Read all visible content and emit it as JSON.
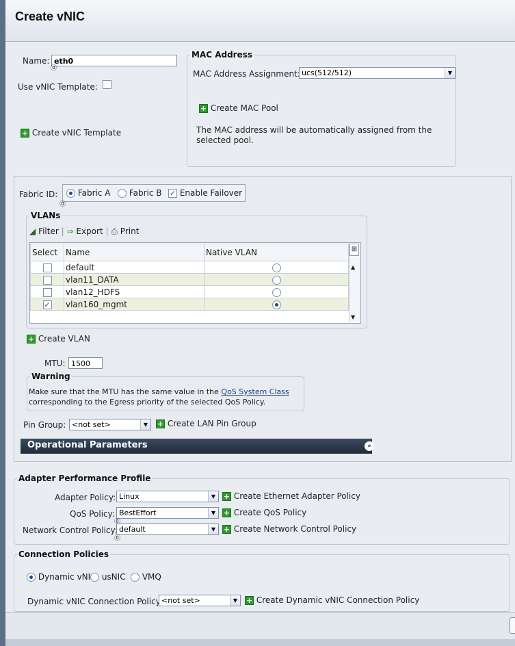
{
  "dialog": {
    "title": "Create vNIC"
  },
  "identity": {
    "name_label": "Name:",
    "name_value": "eth0",
    "use_template_label": "Use vNIC Template:",
    "create_template": "Create vNIC Template"
  },
  "mac": {
    "legend": "MAC Address",
    "assignment_label": "MAC Address Assignment:",
    "assignment_value": "ucs(512/512)",
    "create_pool": "Create MAC Pool",
    "info": "The MAC address will be automatically assigned from the selected pool."
  },
  "fabric": {
    "label": "Fabric ID:",
    "fabric_a": "Fabric A",
    "fabric_b": "Fabric B",
    "failover": "Enable Failover"
  },
  "vlans": {
    "legend": "VLANs",
    "toolbar": {
      "filter": "Filter",
      "export": "Export",
      "print": "Print"
    },
    "columns": [
      "Select",
      "Name",
      "Native VLAN"
    ],
    "rows": [
      {
        "name": "default",
        "selected": false,
        "native": false
      },
      {
        "name": "vlan11_DATA",
        "selected": false,
        "native": false
      },
      {
        "name": "vlan12_HDFS",
        "selected": false,
        "native": false
      },
      {
        "name": "vlan160_mgmt",
        "selected": true,
        "native": true
      }
    ],
    "create_vlan": "Create VLAN"
  },
  "mtu": {
    "label": "MTU:",
    "value": "1500"
  },
  "warning": {
    "legend": "Warning",
    "text_1": "Make sure that the MTU has the same value in the",
    "link": "QoS System Class",
    "text_2": "corresponding to the Egress priority of the selected QoS Policy."
  },
  "pin_group": {
    "label": "Pin Group:",
    "value": "<not set>",
    "create": "Create LAN Pin Group"
  },
  "operational": {
    "label": "Operational Parameters"
  },
  "adapter": {
    "legend": "Adapter Performance Profile",
    "adapter_policy_label": "Adapter Policy:",
    "adapter_policy_value": "Linux",
    "adapter_policy_create": "Create Ethernet Adapter Policy",
    "qos_label": "QoS Policy:",
    "qos_value": "BestEffort",
    "qos_create": "Create QoS Policy",
    "ncp_label": "Network Control Policy:",
    "ncp_value": "default",
    "ncp_create": "Create Network Control Policy"
  },
  "connection": {
    "legend": "Connection Policies",
    "options": [
      "Dynamic vNIC",
      "usNIC",
      "VMQ"
    ],
    "dyn_label": "Dynamic vNIC Connection Policy:",
    "dyn_value": "<not set>",
    "dyn_create": "Create Dynamic vNIC Connection Policy"
  },
  "colors": {
    "accent": "#1e4b88",
    "plus": "#2f9a2c",
    "opbar": "#2a3748"
  }
}
